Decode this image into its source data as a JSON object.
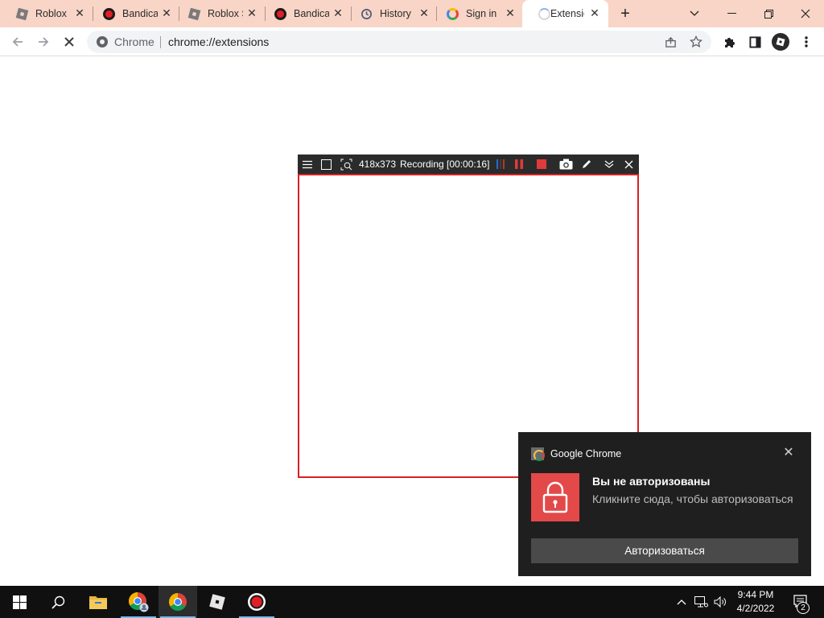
{
  "browser": {
    "tabs": [
      {
        "title": "Roblox",
        "favicon": "roblox-icon",
        "active": false
      },
      {
        "title": "Bandicam",
        "favicon": "bandicam-icon",
        "active": false
      },
      {
        "title": "Roblox Studio",
        "favicon": "roblox-icon",
        "active": false
      },
      {
        "title": "Bandicam",
        "favicon": "bandicam-icon",
        "active": false
      },
      {
        "title": "History",
        "favicon": "history-icon",
        "active": false
      },
      {
        "title": "Sign in",
        "favicon": "google-icon",
        "active": false
      },
      {
        "title": "Extensions",
        "favicon": "loading-spinner-icon",
        "active": true
      }
    ],
    "new_tab_label": "+",
    "omnibox": {
      "site_label": "Chrome",
      "url": "chrome://extensions"
    },
    "tab_strip_color": "#f8d5c6"
  },
  "recorder": {
    "resolution": "418x373",
    "status": "Recording [00:00:16]",
    "frame_color": "#d52222"
  },
  "notification": {
    "app_name": "Google Chrome",
    "title": "Вы не авторизованы",
    "body": "Кликните сюда, чтобы авторизоваться",
    "action_label": "Авторизоваться",
    "image_icon": "lock-icon",
    "image_color": "#e34949"
  },
  "taskbar": {
    "items": [
      "windows-start-icon",
      "search-icon",
      "file-explorer-icon",
      "chrome-icon",
      "chrome-icon",
      "roblox-icon",
      "bandicam-icon"
    ],
    "time": "9:44 PM",
    "date": "4/2/2022",
    "notification_count": "2"
  }
}
